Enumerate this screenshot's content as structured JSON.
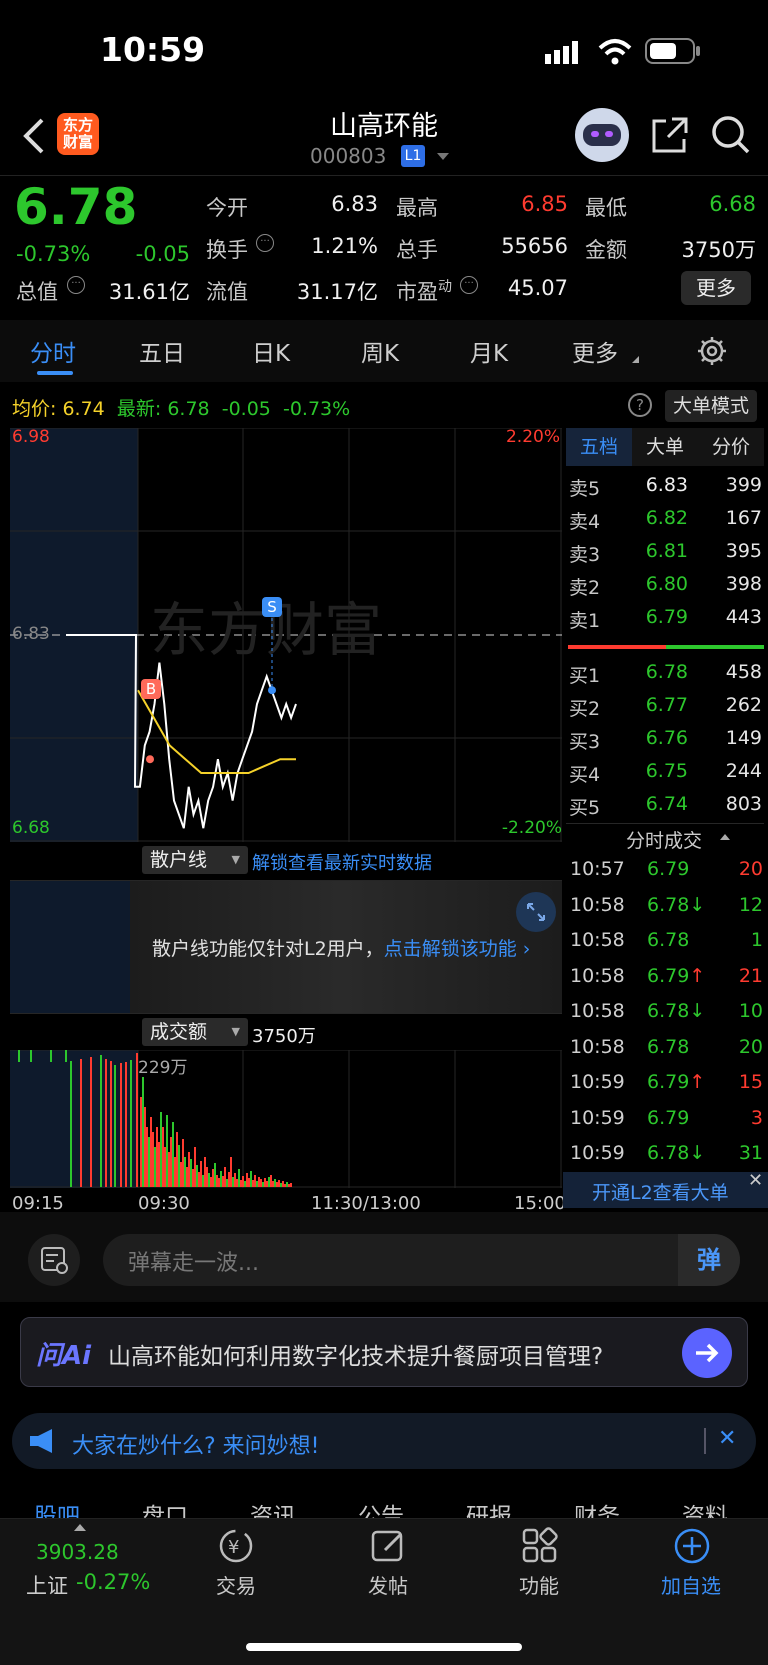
{
  "status_bar": {
    "time": "10:59"
  },
  "header": {
    "logo_text_1": "东方",
    "logo_text_2": "财富",
    "title": "山高环能",
    "code": "000803",
    "badge": "L1"
  },
  "quote": {
    "price": "6.78",
    "change_pct": "-0.73%",
    "change": "-0.05",
    "open_label": "今开",
    "open": "6.83",
    "high_label": "最高",
    "high": "6.85",
    "low_label": "最低",
    "low": "6.68",
    "turnover_label": "换手",
    "turnover": "1.21%",
    "volume_label": "总手",
    "volume": "55656",
    "amount_label": "金额",
    "amount": "3750万",
    "mktcap_label": "总值",
    "mktcap": "31.61亿",
    "float_label": "流值",
    "float": "31.17亿",
    "pe_label": "市盈",
    "pe_sup": "动",
    "pe": "45.07",
    "more_button": "更多"
  },
  "chart_tabs": [
    "分时",
    "五日",
    "日K",
    "周K",
    "月K",
    "更多"
  ],
  "chart_info": {
    "avg_label": "均价:",
    "avg": "6.74",
    "latest_label": "最新:",
    "latest": "6.78",
    "change": "-0.05",
    "change_pct": "-0.73%",
    "big_order_button": "大单模式"
  },
  "chart_data": {
    "type": "line",
    "y_top": "6.98",
    "y_bottom": "6.68",
    "y_mid": "6.83",
    "pct_top": "2.20%",
    "pct_bottom": "-2.20%",
    "ylim": [
      6.68,
      6.98
    ],
    "x_labels": [
      "09:15",
      "09:30",
      "11:30/13:00",
      "15:00"
    ],
    "series": [
      {
        "values": [
          6.83,
          6.83,
          6.83,
          6.72,
          6.72,
          6.75,
          6.76,
          6.78,
          6.81,
          6.78,
          6.74,
          6.71,
          6.7,
          6.69,
          6.72,
          6.7,
          6.71,
          6.69,
          6.71,
          6.72,
          6.74,
          6.72,
          6.73,
          6.71,
          6.73,
          6.74,
          6.75,
          6.76,
          6.78,
          6.79,
          6.8,
          6.79,
          6.78,
          6.77,
          6.78,
          6.77,
          6.78
        ]
      },
      {
        "values": [
          6.79,
          6.77,
          6.75,
          6.74,
          6.73,
          6.73,
          6.73,
          6.73,
          6.735,
          6.74,
          6.74
        ]
      }
    ],
    "markers": [
      "B",
      "S"
    ],
    "volume_label": "成交额",
    "volume_total": "3750万",
    "volume_max": "229万"
  },
  "sanhu": {
    "dropdown": "散户线",
    "unlock_link": "解锁查看最新实时数据",
    "notice": "散户线功能仅针对L2用户，",
    "notice_link": "点击解锁该功能"
  },
  "order_book": {
    "tabs": [
      "五档",
      "大单",
      "分价"
    ],
    "asks": [
      {
        "label": "卖5",
        "price": "6.83",
        "vol": "399",
        "color": "white"
      },
      {
        "label": "卖4",
        "price": "6.82",
        "vol": "167",
        "color": "green"
      },
      {
        "label": "卖3",
        "price": "6.81",
        "vol": "395",
        "color": "green"
      },
      {
        "label": "卖2",
        "price": "6.80",
        "vol": "398",
        "color": "green"
      },
      {
        "label": "卖1",
        "price": "6.79",
        "vol": "443",
        "color": "green"
      }
    ],
    "bids": [
      {
        "label": "买1",
        "price": "6.78",
        "vol": "458"
      },
      {
        "label": "买2",
        "price": "6.77",
        "vol": "262"
      },
      {
        "label": "买3",
        "price": "6.76",
        "vol": "149"
      },
      {
        "label": "买4",
        "price": "6.75",
        "vol": "244"
      },
      {
        "label": "买5",
        "price": "6.74",
        "vol": "803"
      }
    ],
    "trades_title": "分时成交",
    "trades": [
      {
        "time": "10:57",
        "price": "6.79",
        "arrow": "",
        "vol": "20",
        "vcolor": "red"
      },
      {
        "time": "10:58",
        "price": "6.78",
        "arrow": "↓",
        "vol": "12",
        "vcolor": "green"
      },
      {
        "time": "10:58",
        "price": "6.78",
        "arrow": "",
        "vol": "1",
        "vcolor": "green"
      },
      {
        "time": "10:58",
        "price": "6.79",
        "arrow": "↑",
        "vol": "21",
        "vcolor": "red"
      },
      {
        "time": "10:58",
        "price": "6.78",
        "arrow": "↓",
        "vol": "10",
        "vcolor": "green"
      },
      {
        "time": "10:58",
        "price": "6.78",
        "arrow": "",
        "vol": "20",
        "vcolor": "green"
      },
      {
        "time": "10:59",
        "price": "6.79",
        "arrow": "↑",
        "vol": "15",
        "vcolor": "red"
      },
      {
        "time": "10:59",
        "price": "6.79",
        "arrow": "",
        "vol": "3",
        "vcolor": "red"
      },
      {
        "time": "10:59",
        "price": "6.78",
        "arrow": "↓",
        "vol": "31",
        "vcolor": "green"
      }
    ],
    "l2_banner": "开通L2查看大单"
  },
  "danmu": {
    "placeholder": "弹幕走一波...",
    "send": "弹"
  },
  "ai": {
    "label": "问Ai",
    "question": "山高环能如何利用数字化技术提升餐厨项目管理?"
  },
  "notice_bar": {
    "text": "大家在炒什么? 来问妙想!"
  },
  "bottom_tabs": [
    "股吧",
    "盘口",
    "资讯",
    "公告",
    "研报",
    "财务",
    "资料"
  ],
  "nav": {
    "index_value": "3903.28",
    "index_name": "上证",
    "index_change": "-0.27%",
    "trade": "交易",
    "post": "发帖",
    "function": "功能",
    "add": "加自选"
  }
}
